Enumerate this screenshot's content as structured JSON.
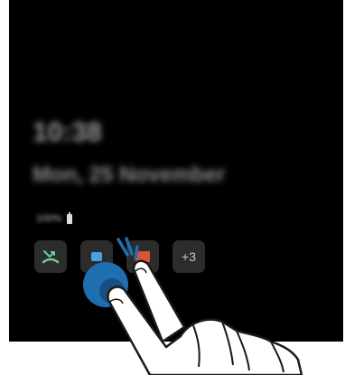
{
  "lockscreen": {
    "time": "10:38",
    "date": "Mon, 25 November",
    "battery_percent": "100%"
  },
  "notifications": {
    "more_label": "+3",
    "icons": [
      "missed-call-icon",
      "message-icon",
      "email-icon"
    ]
  },
  "colors": {
    "screen_bg": "#000000",
    "missed_call": "#6fcf97",
    "touch_blue": "#1f6fb0",
    "email_red": "#d8543f"
  }
}
